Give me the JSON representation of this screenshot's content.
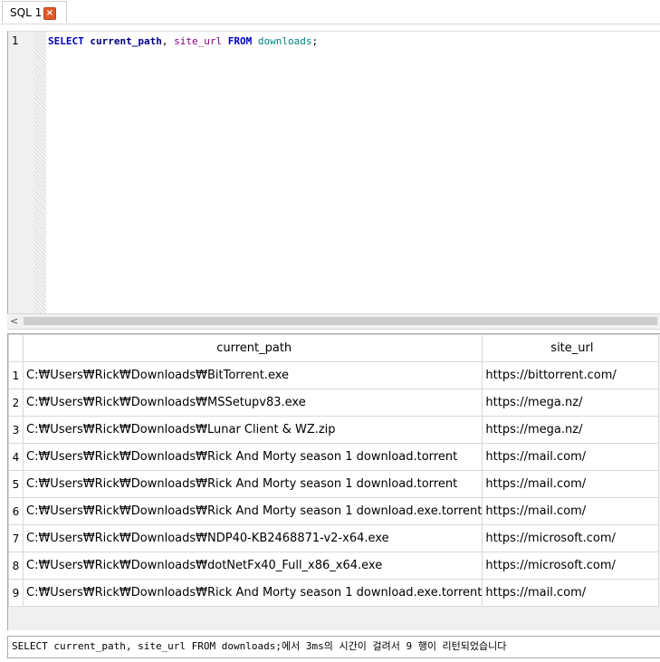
{
  "tab": {
    "label": "SQL 1",
    "close_icon": "×"
  },
  "editor": {
    "line_number": "1",
    "query": {
      "select": "SELECT",
      "col1": "current_path",
      "comma": ",",
      "col2": "site_url",
      "from": "FROM",
      "table": "downloads",
      "semi": ";"
    }
  },
  "scrollbar": {
    "left_arrow": "<"
  },
  "results": {
    "columns": [
      "current_path",
      "site_url"
    ],
    "rows": [
      {
        "n": "1",
        "current_path": "C:₩Users₩Rick₩Downloads₩BitTorrent.exe",
        "site_url": "https://bittorrent.com/"
      },
      {
        "n": "2",
        "current_path": "C:₩Users₩Rick₩Downloads₩MSSetupv83.exe",
        "site_url": "https://mega.nz/"
      },
      {
        "n": "3",
        "current_path": "C:₩Users₩Rick₩Downloads₩Lunar Client & WZ.zip",
        "site_url": "https://mega.nz/"
      },
      {
        "n": "4",
        "current_path": "C:₩Users₩Rick₩Downloads₩Rick And Morty season 1 download.torrent",
        "site_url": "https://mail.com/"
      },
      {
        "n": "5",
        "current_path": "C:₩Users₩Rick₩Downloads₩Rick And Morty season 1 download.torrent",
        "site_url": "https://mail.com/"
      },
      {
        "n": "6",
        "current_path": "C:₩Users₩Rick₩Downloads₩Rick And Morty season 1 download.exe.torrent",
        "site_url": "https://mail.com/"
      },
      {
        "n": "7",
        "current_path": "C:₩Users₩Rick₩Downloads₩NDP40-KB2468871-v2-x64.exe",
        "site_url": "https://microsoft.com/"
      },
      {
        "n": "8",
        "current_path": "C:₩Users₩Rick₩Downloads₩dotNetFx40_Full_x86_x64.exe",
        "site_url": "https://microsoft.com/"
      },
      {
        "n": "9",
        "current_path": "C:₩Users₩Rick₩Downloads₩Rick And Morty season 1 download.exe.torrent",
        "site_url": "https://mail.com/"
      }
    ]
  },
  "status": {
    "message": "SELECT current_path, site_url FROM downloads;에서 3ms의 시간이 걸려서 9 행이 리턴되었습니다"
  }
}
